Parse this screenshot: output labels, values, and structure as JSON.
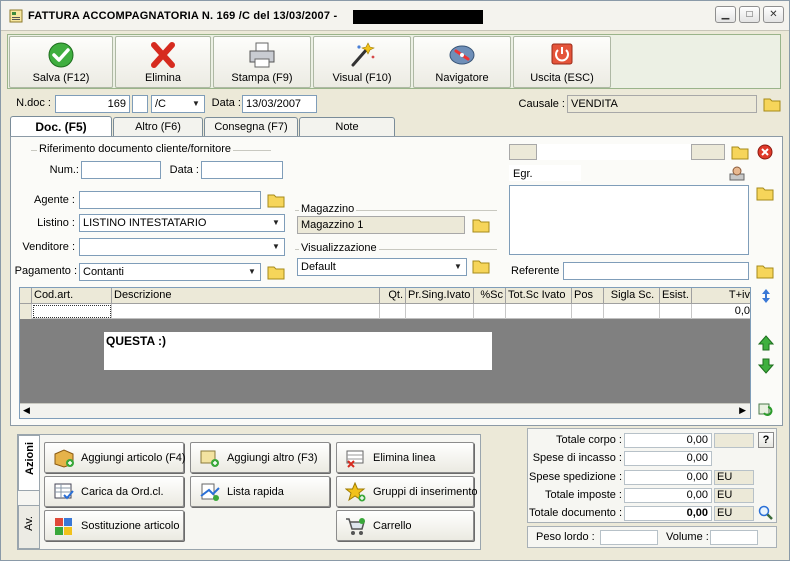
{
  "window": {
    "title": "FATTURA ACCOMPAGNATORIA N. 169 /C del 13/03/2007 -",
    "minimize_glyph": "▁",
    "maximize_glyph": "□",
    "close_glyph": "✕"
  },
  "toolbar": {
    "buttons": [
      {
        "label": "Salva (F12)",
        "icon": "checkmark-icon"
      },
      {
        "label": "Elimina",
        "icon": "red-x-icon"
      },
      {
        "label": "Stampa (F9)",
        "icon": "printer-icon"
      },
      {
        "label": "Visual (F10)",
        "icon": "magic-wand-icon"
      },
      {
        "label": "Navigatore",
        "icon": "compass-icon"
      },
      {
        "label": "Uscita (ESC)",
        "icon": "exit-power-icon"
      }
    ]
  },
  "header": {
    "ndoc_label": "N.doc :",
    "ndoc_value": "169",
    "series_value": "/C",
    "data_label": "Data :",
    "data_value": "13/03/2007",
    "causale_label": "Causale :",
    "causale_value": "VENDITA"
  },
  "tabs": [
    {
      "label": "Doc. (F5)",
      "active": true
    },
    {
      "label": "Altro (F6)",
      "active": false
    },
    {
      "label": "Consegna (F7)",
      "active": false
    },
    {
      "label": "Note",
      "active": false
    }
  ],
  "doc": {
    "rif_group_title": "Riferimento documento cliente/fornitore",
    "num_label": "Num.:",
    "num_value": "",
    "data_label": "Data :",
    "data_value": "",
    "agente_label": "Agente :",
    "agente_value": "",
    "listino_label": "Listino :",
    "listino_value": "LISTINO INTESTATARIO",
    "venditore_label": "Venditore :",
    "venditore_value": "",
    "pagamento_label": "Pagamento :",
    "pagamento_value": "Contanti",
    "magazzino_title": "Magazzino",
    "magazzino_value": "Magazzino 1",
    "visualizzazione_title": "Visualizzazione",
    "visualizzazione_value": "Default",
    "customer_salutation": "Egr.",
    "referente_label": "Referente",
    "referente_value": ""
  },
  "grid": {
    "columns": [
      "Cod.art.",
      "Descrizione",
      "Qt.",
      "Pr.Sing.Ivato",
      "%Sc",
      "Tot.Sc Ivato",
      "Pos",
      "Sigla Sc.",
      "Esist.",
      "T+iv"
    ],
    "first_row_last_value": "0,0",
    "overlay_text": "QUESTA :)"
  },
  "actions": {
    "vtab_main": "Azioni",
    "vtab_secondary": "Av.",
    "buttons": [
      {
        "label": "Aggiungi articolo (F4)",
        "icon": "add-article-icon"
      },
      {
        "label": "Aggiungi altro (F3)",
        "icon": "add-other-icon"
      },
      {
        "label": "Elimina linea",
        "icon": "delete-line-icon"
      },
      {
        "label": "Carica da Ord.cl.",
        "icon": "load-order-icon"
      },
      {
        "label": "Lista rapida",
        "icon": "quick-list-icon"
      },
      {
        "label": "Gruppi di inserimento",
        "icon": "insert-groups-icon"
      },
      {
        "label": "Sostituzione articolo",
        "icon": "replace-article-icon"
      },
      {
        "label": "Carrello",
        "icon": "cart-icon"
      }
    ]
  },
  "totals": {
    "rows": [
      {
        "label": "Totale corpo :",
        "value": "0,00",
        "unit": ""
      },
      {
        "label": "Spese di incasso :",
        "value": "0,00",
        "unit": ""
      },
      {
        "label": "Spese spedizione :",
        "value": "0,00",
        "unit": "EU"
      },
      {
        "label": "Totale imposte :",
        "value": "0,00",
        "unit": "EU"
      },
      {
        "label": "Totale documento :",
        "value": "0,00",
        "unit": "EU"
      }
    ],
    "help_label": "?",
    "peso_label": "Peso lordo :",
    "peso_value": "",
    "volume_label": "Volume :",
    "volume_value": ""
  },
  "colors": {
    "titlebar_bg": "#f4f3ee",
    "toolbar_border": "#9ab48a",
    "window_bg": "#ece9d8",
    "grid_bg": "#808080"
  }
}
